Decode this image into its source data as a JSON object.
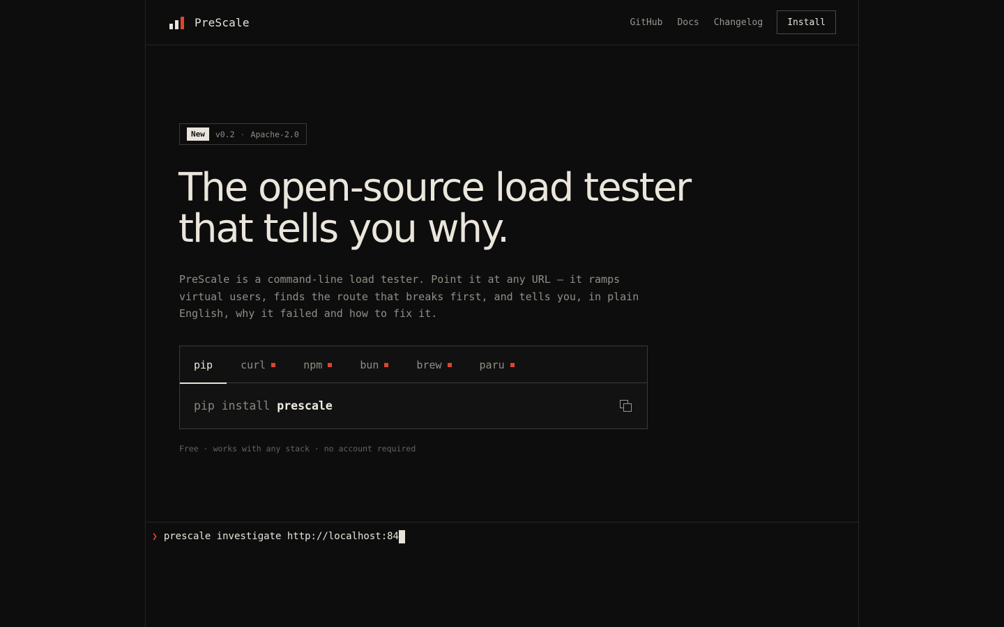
{
  "header": {
    "brand": "PreScale",
    "nav": [
      "GitHub",
      "Docs",
      "Changelog"
    ],
    "install_label": "Install"
  },
  "badge": {
    "new": "New",
    "version": "v0.2",
    "separator": "·",
    "license": "Apache-2.0"
  },
  "hero": {
    "title_line1": "The open-source load tester",
    "title_line2": "that tells you why.",
    "description": "PreScale is a command-line load tester. Point it at any URL — it ramps virtual users, finds the route that breaks first, and tells you, in plain English, why it failed and how to fix it."
  },
  "install": {
    "tabs": [
      {
        "label": "pip",
        "active": true,
        "marker": false
      },
      {
        "label": "curl",
        "active": false,
        "marker": true
      },
      {
        "label": "npm",
        "active": false,
        "marker": true
      },
      {
        "label": "bun",
        "active": false,
        "marker": true
      },
      {
        "label": "brew",
        "active": false,
        "marker": true
      },
      {
        "label": "paru",
        "active": false,
        "marker": true
      }
    ],
    "command_prefix": "pip install",
    "command_package": "prescale"
  },
  "footnote": "Free · works with any stack · no account required",
  "terminal": {
    "prompt": "❯",
    "input": "prescale investigate http://localhost:84"
  },
  "colors": {
    "background": "#0d0d0d",
    "text": "#e8e4dc",
    "muted": "#928e87",
    "accent": "#e0442f",
    "border": "#3a3a3a"
  },
  "icons": {
    "logo": "bar-chart-icon",
    "copy": "copy-icon",
    "tab_marker": "square-marker-icon"
  }
}
